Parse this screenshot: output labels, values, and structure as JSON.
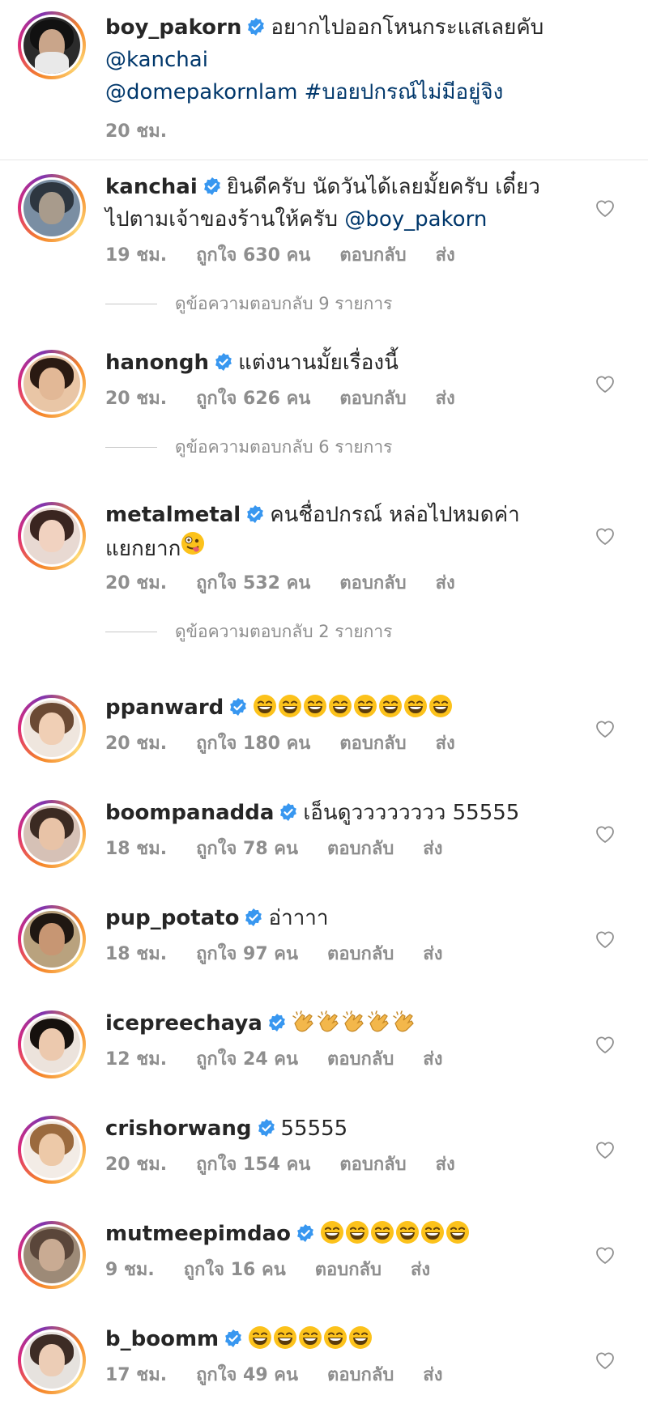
{
  "caption": {
    "username": "boy_pakorn",
    "text": "อยากไปออกโหนกระแสเลยคับ",
    "mention1": "@kanchai",
    "mention2": "@domepakornlam",
    "hashtag": "#บอยปกรณ์ไม่มีอยู่จิง",
    "time": "20 ชม."
  },
  "labels": {
    "reply": "ตอบกลับ",
    "send": "ส่ง"
  },
  "colors": {
    "verified": "#3897f0",
    "link": "#00376b",
    "meta": "#8e8e8e"
  },
  "comments": [
    {
      "username": "kanchai",
      "text_line1": "ยินดีครับ นัดวันได้เลยมั้ยครับ เดี๋ยว",
      "text_line2": "ไปตามเจ้าของร้านให้ครับ",
      "mention": "@boy_pakorn",
      "time": "19 ชม.",
      "likes": "ถูกใจ 630 คน",
      "view_replies": "ดูข้อความตอบกลับ 9 รายการ"
    },
    {
      "username": "hanongh",
      "text_line1": "แต่งนานมั้ยเรื่องนี้",
      "time": "20 ชม.",
      "likes": "ถูกใจ 626 คน",
      "view_replies": "ดูข้อความตอบกลับ 6 รายการ"
    },
    {
      "username": "metalmetal",
      "text_line1": "คนชื่อปกรณ์ หล่อไปหมดค่า",
      "text_line2": "แยกยาก",
      "emoji": "zany-face",
      "time": "20 ชม.",
      "likes": "ถูกใจ 532 คน",
      "view_replies": "ดูข้อความตอบกลับ 2 รายการ"
    },
    {
      "username": "ppanward",
      "emoji": "laughing-face",
      "emoji_count": 8,
      "time": "20 ชม.",
      "likes": "ถูกใจ 180 คน"
    },
    {
      "username": "boompanadda",
      "text_line1": "เอ็นดูวววววววว 55555",
      "time": "18 ชม.",
      "likes": "ถูกใจ 78 คน"
    },
    {
      "username": "pup_potato",
      "text_line1": "อ่าาาา",
      "time": "18 ชม.",
      "likes": "ถูกใจ 97 คน"
    },
    {
      "username": "icepreechaya",
      "emoji": "clapping-hands",
      "emoji_count": 5,
      "time": "12 ชม.",
      "likes": "ถูกใจ 24 คน"
    },
    {
      "username": "crishorwang",
      "text_line1": "55555",
      "time": "20 ชม.",
      "likes": "ถูกใจ 154 คน"
    },
    {
      "username": "mutmeepimdao",
      "emoji": "laughing-face",
      "emoji_count": 6,
      "time": "9 ชม.",
      "likes": "ถูกใจ 16 คน"
    },
    {
      "username": "b_boomm",
      "emoji": "laughing-face",
      "emoji_count": 5,
      "time": "17 ชม.",
      "likes": "ถูกใจ 49 คน"
    }
  ]
}
